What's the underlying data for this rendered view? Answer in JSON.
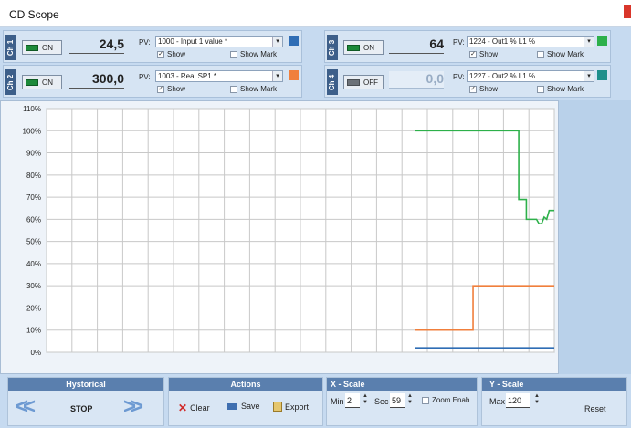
{
  "window": {
    "title": "CD Scope"
  },
  "channels": [
    {
      "label": "Ch 1",
      "state": "ON",
      "value": "24,5",
      "pv_prefix": "PV:",
      "pv": "1000 - Input 1 value *",
      "color": "#2f6db5",
      "show_label": "Show",
      "show_checked": true,
      "showmark_label": "Show Mark",
      "showmark_checked": false,
      "value_dim": false
    },
    {
      "label": "Ch 2",
      "state": "ON",
      "value": "300,0",
      "pv_prefix": "PV:",
      "pv": "1003 - Real SP1 *",
      "color": "#f07f3c",
      "show_label": "Show",
      "show_checked": true,
      "showmark_label": "Show Mark",
      "showmark_checked": false,
      "value_dim": false
    },
    {
      "label": "Ch 3",
      "state": "ON",
      "value": "64",
      "pv_prefix": "PV:",
      "pv": "1224 - Out1 % L1 %",
      "color": "#2db04a",
      "show_label": "Show",
      "show_checked": true,
      "showmark_label": "Show Mark",
      "showmark_checked": false,
      "value_dim": false
    },
    {
      "label": "Ch 4",
      "state": "OFF",
      "value": "0,0",
      "pv_prefix": "PV:",
      "pv": "1227 - Out2 % L1 %",
      "color": "#1f8f8a",
      "show_label": "Show",
      "show_checked": true,
      "showmark_label": "Show Mark",
      "showmark_checked": false,
      "value_dim": true
    }
  ],
  "chart_data": {
    "type": "line",
    "yticks": [
      "110%",
      "100%",
      "90%",
      "80%",
      "70%",
      "60%",
      "50%",
      "40%",
      "30%",
      "20%",
      "10%",
      "0%"
    ],
    "ylim": [
      0,
      110
    ],
    "xlim": [
      0,
      20
    ],
    "grid": true,
    "series": [
      {
        "color": "#2db04a",
        "points": [
          [
            14.5,
            100
          ],
          [
            18.6,
            100
          ],
          [
            18.6,
            69
          ],
          [
            18.9,
            69
          ],
          [
            18.9,
            60
          ],
          [
            19.3,
            60
          ],
          [
            19.4,
            58
          ],
          [
            19.5,
            58
          ],
          [
            19.6,
            61
          ],
          [
            19.7,
            60
          ],
          [
            19.8,
            64
          ],
          [
            20,
            64
          ]
        ]
      },
      {
        "color": "#f07f3c",
        "points": [
          [
            14.5,
            10
          ],
          [
            16.8,
            10
          ],
          [
            16.8,
            30
          ],
          [
            20,
            30
          ]
        ]
      },
      {
        "color": "#2f6db5",
        "points": [
          [
            14.5,
            2
          ],
          [
            20,
            2
          ]
        ]
      }
    ]
  },
  "historical": {
    "header": "Hystorical",
    "stop_label": "STOP",
    "back_icon": "double-chevron-left-icon",
    "forward_icon": "double-chevron-right-icon"
  },
  "actions": {
    "header": "Actions",
    "clear_label": "Clear",
    "save_label": "Save",
    "export_label": "Export"
  },
  "xscale": {
    "header": "X - Scale",
    "min_label": "Min",
    "min_value": "2",
    "sec_label": "Sec",
    "sec_value": "59",
    "zoom_label": "Zoom Enab",
    "zoom_checked": false
  },
  "yscale": {
    "header": "Y - Scale",
    "max_label": "Max",
    "max_value": "120",
    "reset_label": "Reset"
  }
}
